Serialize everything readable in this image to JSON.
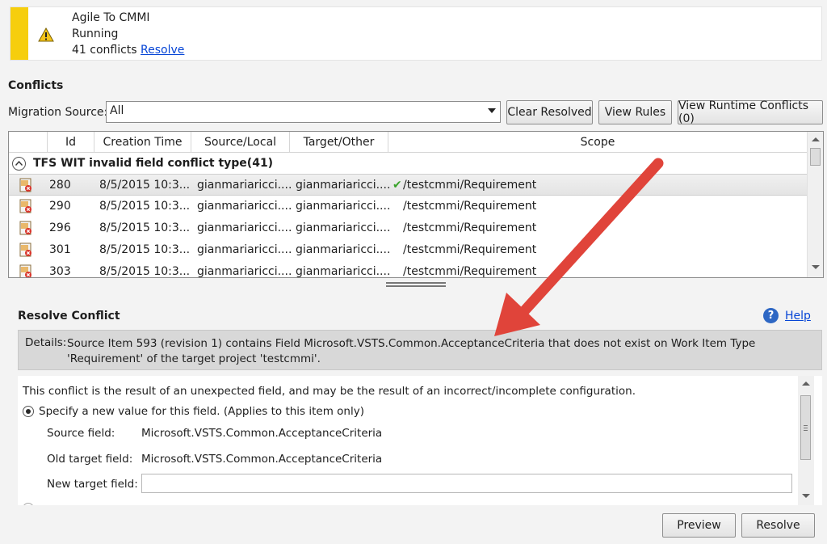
{
  "banner": {
    "name": "Agile To CMMI",
    "status": "Running",
    "conflicts_text": "41 conflicts",
    "resolve_link": "Resolve"
  },
  "conflicts": {
    "title": "Conflicts",
    "migration_source_label": "Migration Source:",
    "migration_source_value": "All",
    "buttons": {
      "clear_resolved": "Clear Resolved",
      "view_rules": "View Rules",
      "view_runtime_conflicts": "View Runtime Conflicts (0)"
    }
  },
  "grid": {
    "columns": [
      "Id",
      "Creation Time",
      "Source/Local",
      "Target/Other",
      "Scope"
    ],
    "group_title": "TFS WIT invalid field conflict type(41)",
    "rows": [
      {
        "id": "280",
        "time": "8/5/2015 10:3...",
        "source": "gianmariaricci....",
        "target": "gianmariaricci....",
        "scope": "/testcmmi/Requirement",
        "checked": true
      },
      {
        "id": "290",
        "time": "8/5/2015 10:3...",
        "source": "gianmariaricci....",
        "target": "gianmariaricci....",
        "scope": "/testcmmi/Requirement",
        "checked": false
      },
      {
        "id": "296",
        "time": "8/5/2015 10:3...",
        "source": "gianmariaricci....",
        "target": "gianmariaricci....",
        "scope": "/testcmmi/Requirement",
        "checked": false
      },
      {
        "id": "301",
        "time": "8/5/2015 10:3...",
        "source": "gianmariaricci....",
        "target": "gianmariaricci....",
        "scope": "/testcmmi/Requirement",
        "checked": false
      },
      {
        "id": "303",
        "time": "8/5/2015 10:3...",
        "source": "gianmariaricci....",
        "target": "gianmariaricci....",
        "scope": "/testcmmi/Requirement",
        "checked": false
      }
    ]
  },
  "resolve": {
    "title": "Resolve Conflict",
    "help_link": "Help",
    "details_label": "Details:",
    "details_text": "Source Item 593 (revision 1) contains Field Microsoft.VSTS.Common.AcceptanceCriteria that does not exist on Work Item Type 'Requirement' of the target project 'testcmmi'.",
    "description": "This conflict is the result of an unexpected field, and may be the result of an incorrect/incomplete configuration.",
    "option1_label": "Specify a new value for this field.  (Applies to this item only)",
    "source_field_label": "Source field:",
    "source_field_value": "Microsoft.VSTS.Common.AcceptanceCriteria",
    "old_target_label": "Old target field:",
    "old_target_value": "Microsoft.VSTS.Common.AcceptanceCriteria",
    "new_target_label": "New target field:",
    "new_target_value": "",
    "preview_button": "Preview",
    "resolve_button": "Resolve"
  },
  "colors": {
    "banner_accent": "#f6ce0d",
    "annotation_arrow": "#e0443a",
    "link": "#0645d6",
    "check": "#39a32a"
  }
}
